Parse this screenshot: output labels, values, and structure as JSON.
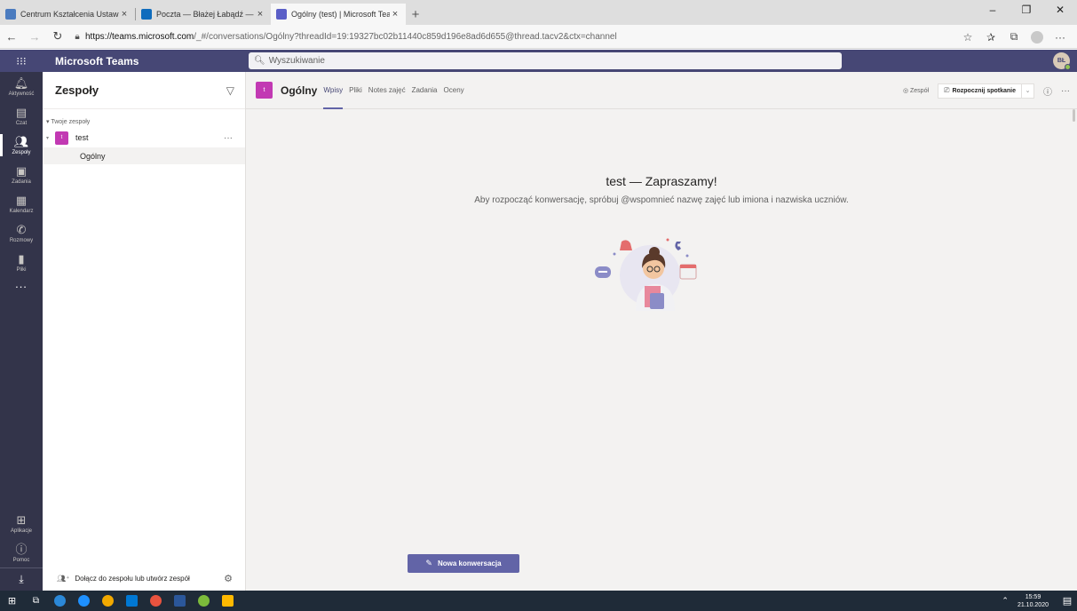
{
  "browser": {
    "tabs": [
      {
        "title": "Centrum Kształcenia Ustawiczne",
        "favicon_color": "#4a7bbf",
        "active": false
      },
      {
        "title": "Poczta — Błażej Łabądź — Outlo",
        "favicon_color": "#0f6cbd",
        "active": false
      },
      {
        "title": "Ogólny (test) | Microsoft Teams",
        "favicon_color": "#5b5fc7",
        "active": true
      }
    ],
    "new_tab": "+",
    "url_host": "https://teams.microsoft.com",
    "url_path": "/_#/conversations/Ogólny?threadId=19:19327bc02b11440c859d196e8ad6d655@thread.tacv2&ctx=channel"
  },
  "teams_header": {
    "app_name": "Microsoft Teams",
    "search_placeholder": "Wyszukiwanie",
    "user_initials": "BŁ"
  },
  "rail": {
    "items": [
      {
        "label": "Aktywność",
        "icon": "bell-icon"
      },
      {
        "label": "Czat",
        "icon": "chat-icon"
      },
      {
        "label": "Zespoły",
        "icon": "teams-icon",
        "active": true
      },
      {
        "label": "Zadania",
        "icon": "assignments-icon"
      },
      {
        "label": "Kalendarz",
        "icon": "calendar-icon"
      },
      {
        "label": "Rozmowy",
        "icon": "phone-icon"
      },
      {
        "label": "Pliki",
        "icon": "file-icon"
      }
    ],
    "more": "...",
    "bottom_items": [
      {
        "label": "Aplikacje",
        "icon": "apps-icon"
      },
      {
        "label": "Pomoc",
        "icon": "help-icon"
      }
    ]
  },
  "teams_pane": {
    "title": "Zespoły",
    "section_label": "Twoje zespoły",
    "team": {
      "name": "test",
      "tile_letter": "t",
      "more": "···"
    },
    "channel": "Ogólny",
    "footer_label": "Dołącz do zespołu lub utwórz zespół"
  },
  "channel": {
    "tile_letter": "t",
    "title": "Ogólny",
    "tabs": [
      "Wpisy",
      "Pliki",
      "Notes zajęć",
      "Zadania",
      "Oceny"
    ],
    "active_tab": "Wpisy",
    "team_link": "Zespół",
    "meet_button": "Rozpocznij spotkanie",
    "welcome_title": "test — Zapraszamy!",
    "welcome_sub": "Aby rozpocząć konwersację, spróbuj @wspomnieć nazwę zajęć lub imiona i nazwiska uczniów.",
    "new_conversation": "Nowa konwersacja"
  },
  "taskbar": {
    "time": "15:59",
    "date": "21.10.2020",
    "app_colors": [
      "#2b88d8",
      "#1e90ff",
      "#f2a900",
      "#0078d4",
      "#e8533f",
      "#2b579a",
      "#7cbb3b",
      "#ffb900"
    ]
  },
  "colors": {
    "teams_purple": "#464775",
    "rail": "#33344a",
    "accent": "#6264a7",
    "team_tile": "#c239b3"
  }
}
